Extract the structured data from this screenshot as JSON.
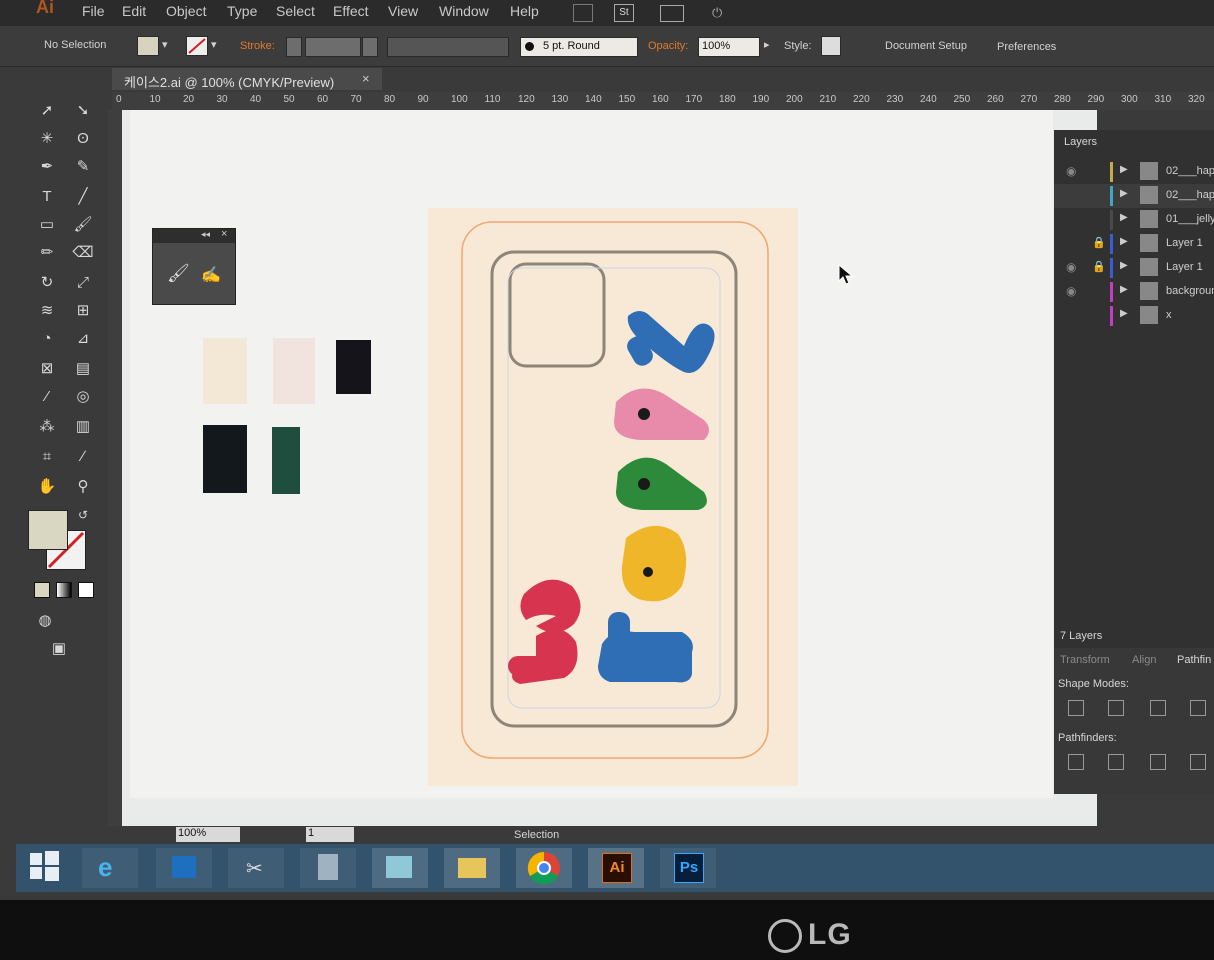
{
  "app": {
    "logo": "Ai"
  },
  "menubar": {
    "items": [
      "File",
      "Edit",
      "Object",
      "Type",
      "Select",
      "Effect",
      "View",
      "Window",
      "Help"
    ],
    "icon_st": "St"
  },
  "control_bar": {
    "selection_label": "No Selection",
    "stroke_label": "Stroke:",
    "brush_label": "5 pt. Round",
    "opacity_label": "Opacity:",
    "opacity_value": "100%",
    "style_label": "Style:",
    "document_setup": "Document Setup",
    "preferences": "Preferences"
  },
  "document": {
    "tab_title": "케이스2.ai @ 100% (CMYK/Preview)",
    "close": "×"
  },
  "ruler": {
    "top": [
      "0",
      "10",
      "20",
      "30",
      "40",
      "50",
      "60",
      "70",
      "80",
      "90",
      "100",
      "110",
      "120",
      "130",
      "140",
      "150",
      "160",
      "170",
      "180",
      "190",
      "200",
      "210",
      "220",
      "230",
      "240",
      "250",
      "260",
      "270",
      "280",
      "290",
      "300",
      "310",
      "320"
    ]
  },
  "artwork": {
    "words": [
      "be",
      "happy"
    ],
    "letters": [
      "b",
      "e",
      "h",
      "a",
      "p",
      "p",
      "y"
    ]
  },
  "layers_panel": {
    "title": "Layers",
    "count": "7 Layers",
    "items": [
      {
        "name": "02___hap",
        "color": "#c9a94a"
      },
      {
        "name": "02___hap",
        "color": "#3fa7c6"
      },
      {
        "name": "01___jelly",
        "color": "#4a4a4a"
      },
      {
        "name": "Layer 1",
        "color": "#3b5bd6"
      },
      {
        "name": "Layer 1",
        "color": "#3b5bd6"
      },
      {
        "name": "backgroun",
        "color": "#c43bc4"
      },
      {
        "name": "x",
        "color": "#c43bc4"
      }
    ]
  },
  "pathfinder_panel": {
    "tabs": [
      "Transform",
      "Align",
      "Pathfin"
    ],
    "shape_modes": "Shape Modes:",
    "pathfinders": "Pathfinders:"
  },
  "status_bar": {
    "zoom": "100%",
    "page": "1",
    "mode": "Selection"
  },
  "taskbar": {
    "ai_label": "Ai",
    "ps_label": "Ps"
  },
  "bezel": {
    "brand": "LG"
  },
  "colors": {
    "letter_blue": "#2f6db5",
    "letter_pink": "#e88aaa",
    "letter_green": "#2c8a3a",
    "letter_yellow": "#f0b62a",
    "letter_red": "#d6344f",
    "swatch_dark": "#13181d",
    "swatch_green": "#1f4d3e"
  }
}
